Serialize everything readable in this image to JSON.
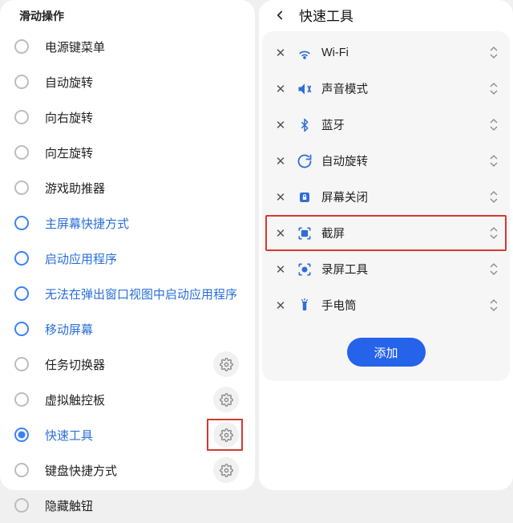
{
  "left": {
    "header": "滑动操作",
    "items": [
      {
        "label": "电源键菜单",
        "style": "gray",
        "gear": false
      },
      {
        "label": "自动旋转",
        "style": "gray",
        "gear": false
      },
      {
        "label": "向右旋转",
        "style": "gray",
        "gear": false
      },
      {
        "label": "向左旋转",
        "style": "gray",
        "gear": false
      },
      {
        "label": "游戏助推器",
        "style": "gray",
        "gear": false
      },
      {
        "label": "主屏幕快捷方式",
        "style": "blue",
        "gear": false
      },
      {
        "label": "启动应用程序",
        "style": "blue",
        "gear": false
      },
      {
        "label": "无法在弹出窗口视图中启动应用程序",
        "style": "blue",
        "gear": false
      },
      {
        "label": "移动屏幕",
        "style": "blue",
        "gear": false
      },
      {
        "label": "任务切换器",
        "style": "gray",
        "gear": true
      },
      {
        "label": "虚拟触控板",
        "style": "gray",
        "gear": true
      },
      {
        "label": "快速工具",
        "style": "selected",
        "gear": true,
        "gear_highlight": true
      },
      {
        "label": "键盘快捷方式",
        "style": "gray",
        "gear": true
      },
      {
        "label": "隐藏触钮",
        "style": "gray",
        "gear": false
      }
    ]
  },
  "right": {
    "title": "快速工具",
    "tools": [
      {
        "icon": "wifi",
        "label": "Wi-Fi"
      },
      {
        "icon": "sound",
        "label": "声音模式"
      },
      {
        "icon": "bluetooth",
        "label": "蓝牙"
      },
      {
        "icon": "rotate",
        "label": "自动旋转"
      },
      {
        "icon": "lock",
        "label": "屏幕关闭"
      },
      {
        "icon": "screenshot",
        "label": "截屏",
        "highlight": true
      },
      {
        "icon": "record",
        "label": "录屏工具"
      },
      {
        "icon": "flashlight",
        "label": "手电筒"
      }
    ],
    "add_label": "添加"
  }
}
